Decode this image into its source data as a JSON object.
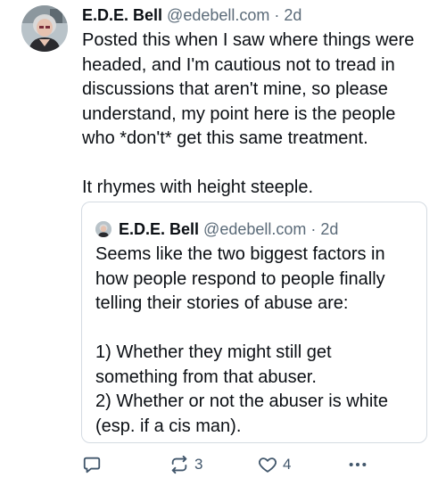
{
  "post": {
    "author_name": "E.D.E. Bell",
    "handle": "@edebell.com",
    "separator": "·",
    "time": "2d",
    "text_lines": [
      "Posted this when I saw where things were",
      "headed, and I'm cautious not to tread in",
      "discussions that aren't mine, so please",
      "understand, my point here is the people",
      "who *don't* get this same treatment."
    ],
    "text_line2": "It rhymes with height steeple."
  },
  "quote": {
    "author_name": "E.D.E. Bell",
    "handle": "@edebell.com",
    "separator": "·",
    "time": "2d",
    "text_lines": [
      "Seems like the two biggest factors in",
      "how people respond to people finally",
      "telling their stories of abuse are:"
    ],
    "list_lines": [
      "1) Whether they might still get",
      "something from that abuser.",
      "2) Whether or not the abuser is white",
      "(esp. if a cis man)."
    ]
  },
  "actions": {
    "reply_icon": "reply-icon",
    "repost_icon": "repost-icon",
    "repost_count": "3",
    "like_icon": "heart-icon",
    "like_count": "4",
    "more_icon": "more-icon"
  },
  "colors": {
    "text": "#0b0f14",
    "secondary": "#5b6b79",
    "icon": "#42576c",
    "border": "#d4dbe2"
  }
}
